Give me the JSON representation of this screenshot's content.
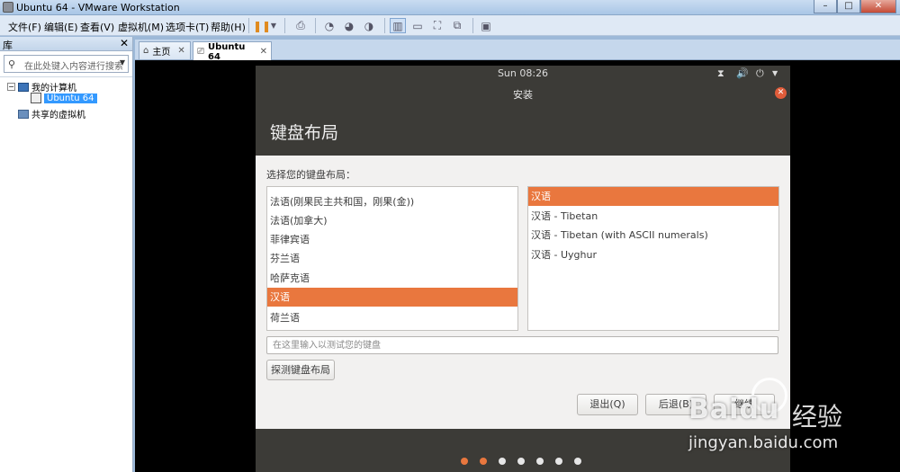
{
  "window": {
    "title": "Ubuntu 64 - VMware Workstation",
    "minimize": "–",
    "maximize": "□",
    "close": "✕"
  },
  "menu": [
    "文件(F)",
    "编辑(E)",
    "查看(V)",
    "虚拟机(M)",
    "选项卡(T)",
    "帮助(H)"
  ],
  "library": {
    "title": "库",
    "close": "✕",
    "search_placeholder": "在此处键入内容进行搜索",
    "tree": {
      "my_computer": "我的计算机",
      "vm": "Ubuntu 64",
      "shared": "共享的虚拟机"
    }
  },
  "tabs": [
    {
      "label": "主页",
      "close": "✕"
    },
    {
      "label": "Ubuntu 64",
      "close": "✕"
    }
  ],
  "guest": {
    "clock": "Sun 08:26",
    "dialog_title": "安装",
    "page_title": "键盘布局",
    "prompt": "选择您的键盘布局：",
    "layouts": [
      "法语(刚果民主共和国，刚果(金))",
      "法语(加拿大)",
      "菲律宾语",
      "芬兰语",
      "哈萨克语",
      "汉语",
      "荷兰语"
    ],
    "selected_layout": "汉语",
    "variants": [
      "汉语",
      "汉语 - Tibetan",
      "汉语 - Tibetan (with ASCII numerals)",
      "汉语 - Uyghur"
    ],
    "selected_variant": "汉语",
    "test_placeholder": "在这里输入以测试您的键盘",
    "detect_button": "探测键盘布局",
    "quit_button": "退出(Q)",
    "back_button": "后退(B)",
    "continue_button": "继续",
    "progress": {
      "total_steps": 7,
      "completed_steps": 2
    }
  },
  "watermark": {
    "brand": "Baidu",
    "suffix": "经验",
    "url": "jingyan.baidu.com"
  }
}
